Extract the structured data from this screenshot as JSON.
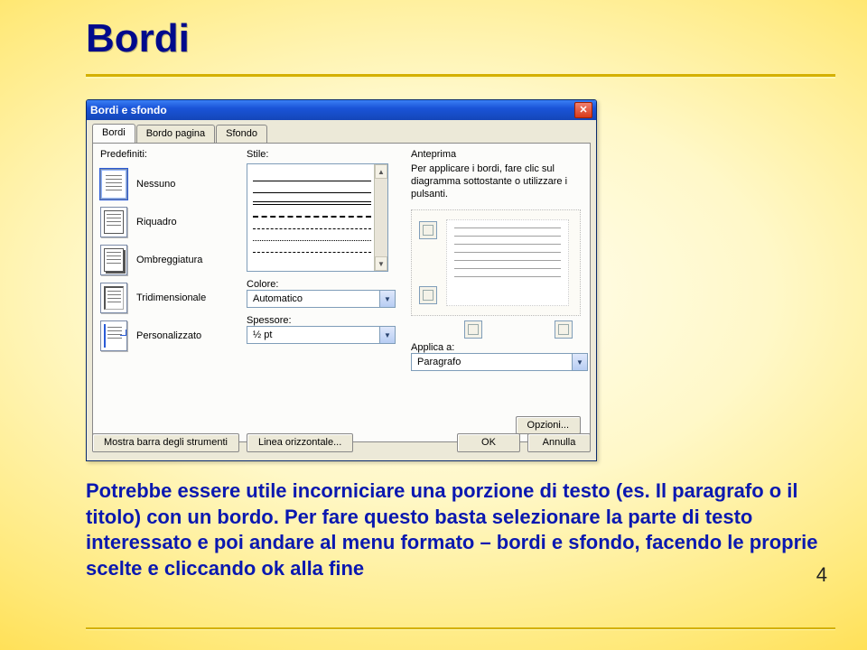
{
  "slide": {
    "title": "Bordi",
    "page_number": "4",
    "body": "Potrebbe essere utile incorniciare una porzione di testo (es. Il paragrafo o il titolo) con un bordo. Per fare questo basta selezionare la parte di testo interessato e poi andare al menu formato – bordi e sfondo, facendo le proprie scelte e cliccando ok alla fine"
  },
  "dialog": {
    "title": "Bordi e sfondo",
    "tabs": [
      "Bordi",
      "Bordo pagina",
      "Sfondo"
    ],
    "active_tab": 0,
    "labels": {
      "predefiniti": "Predefiniti:",
      "stile": "Stile:",
      "colore": "Colore:",
      "spessore": "Spessore:",
      "anteprima": "Anteprima",
      "hint": "Per applicare i bordi, fare clic sul diagramma sottostante o utilizzare i pulsanti.",
      "applica": "Applica a:"
    },
    "presets": [
      {
        "key": "nessuno",
        "label": "Nessuno"
      },
      {
        "key": "riquadro",
        "label": "Riquadro"
      },
      {
        "key": "ombreggiatura",
        "label": "Ombreggiatura"
      },
      {
        "key": "tridimensionale",
        "label": "Tridimensionale"
      },
      {
        "key": "personalizzato",
        "label": "Personalizzato"
      }
    ],
    "color_value": "Automatico",
    "width_value": "½ pt",
    "apply_value": "Paragrafo",
    "buttons": {
      "opzioni": "Opzioni...",
      "toolbar": "Mostra barra degli strumenti",
      "hline": "Linea orizzontale...",
      "ok": "OK",
      "cancel": "Annulla"
    }
  }
}
